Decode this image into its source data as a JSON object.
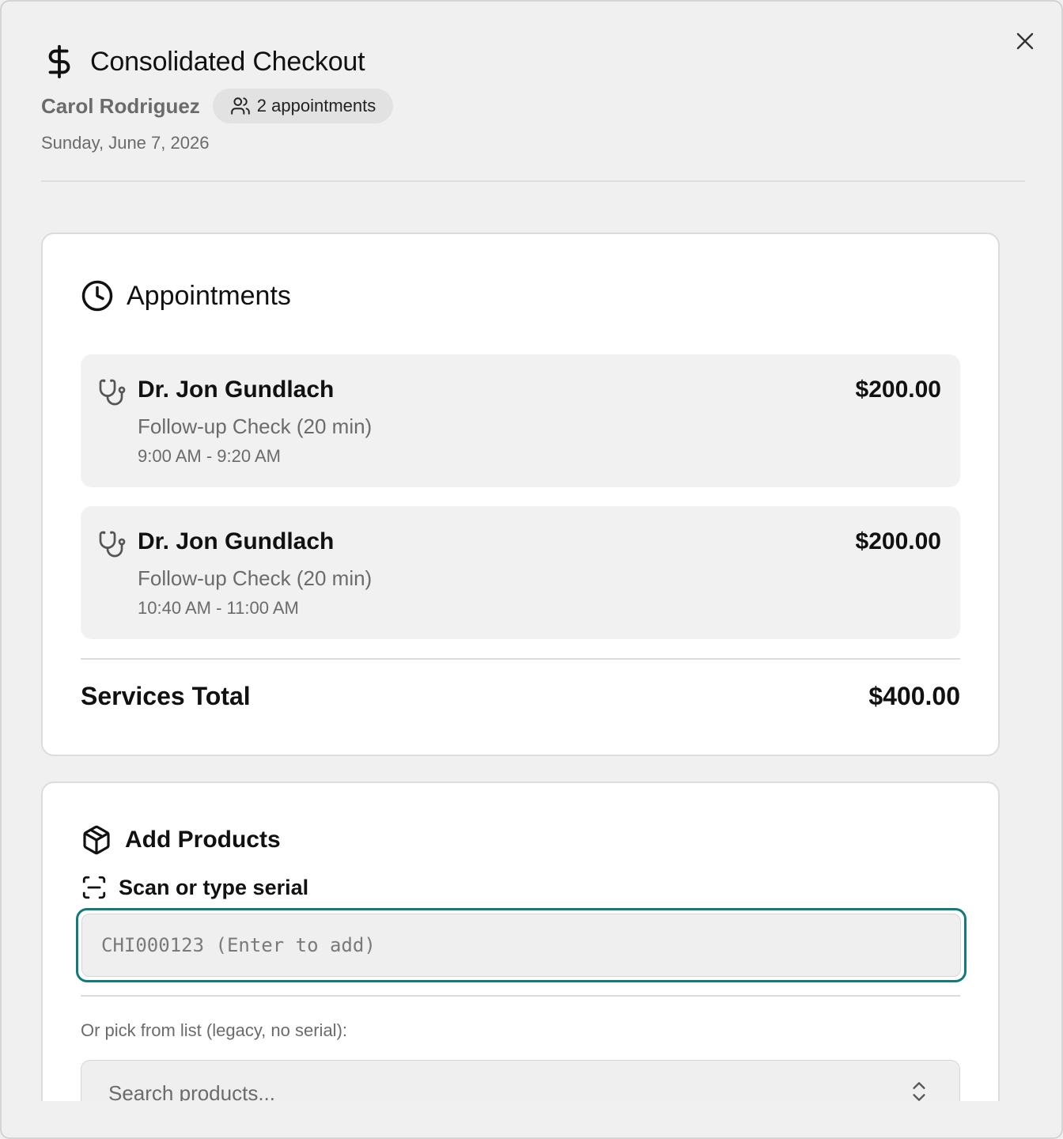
{
  "header": {
    "title": "Consolidated Checkout",
    "patient": "Carol Rodriguez",
    "appointment_count": "2 appointments",
    "date": "Sunday, June 7, 2026"
  },
  "appointments": {
    "heading": "Appointments",
    "items": [
      {
        "doctor": "Dr. Jon Gundlach",
        "service": "Follow-up Check (20 min)",
        "time": "9:00 AM - 9:20 AM",
        "price": "$200.00"
      },
      {
        "doctor": "Dr. Jon Gundlach",
        "service": "Follow-up Check (20 min)",
        "time": "10:40 AM - 11:00 AM",
        "price": "$200.00"
      }
    ],
    "total_label": "Services Total",
    "total_value": "$400.00"
  },
  "products": {
    "heading": "Add Products",
    "scan_label": "Scan or type serial",
    "serial_value": "",
    "serial_placeholder": "CHI000123 (Enter to add)",
    "legacy_label": "Or pick from list (legacy, no serial):",
    "search_placeholder": "Search products..."
  },
  "icons": {
    "title": "dollar-icon",
    "badge": "users-icon",
    "appointments": "clock-icon",
    "appointment_item": "stethoscope-icon",
    "products": "package-icon",
    "scan": "scan-icon",
    "select": "chevrons-up-down-icon",
    "close": "close-icon"
  },
  "colors": {
    "accent": "#117a7a",
    "background": "#f0f0f0",
    "card": "#ffffff",
    "muted_text": "#6b6b6b"
  }
}
